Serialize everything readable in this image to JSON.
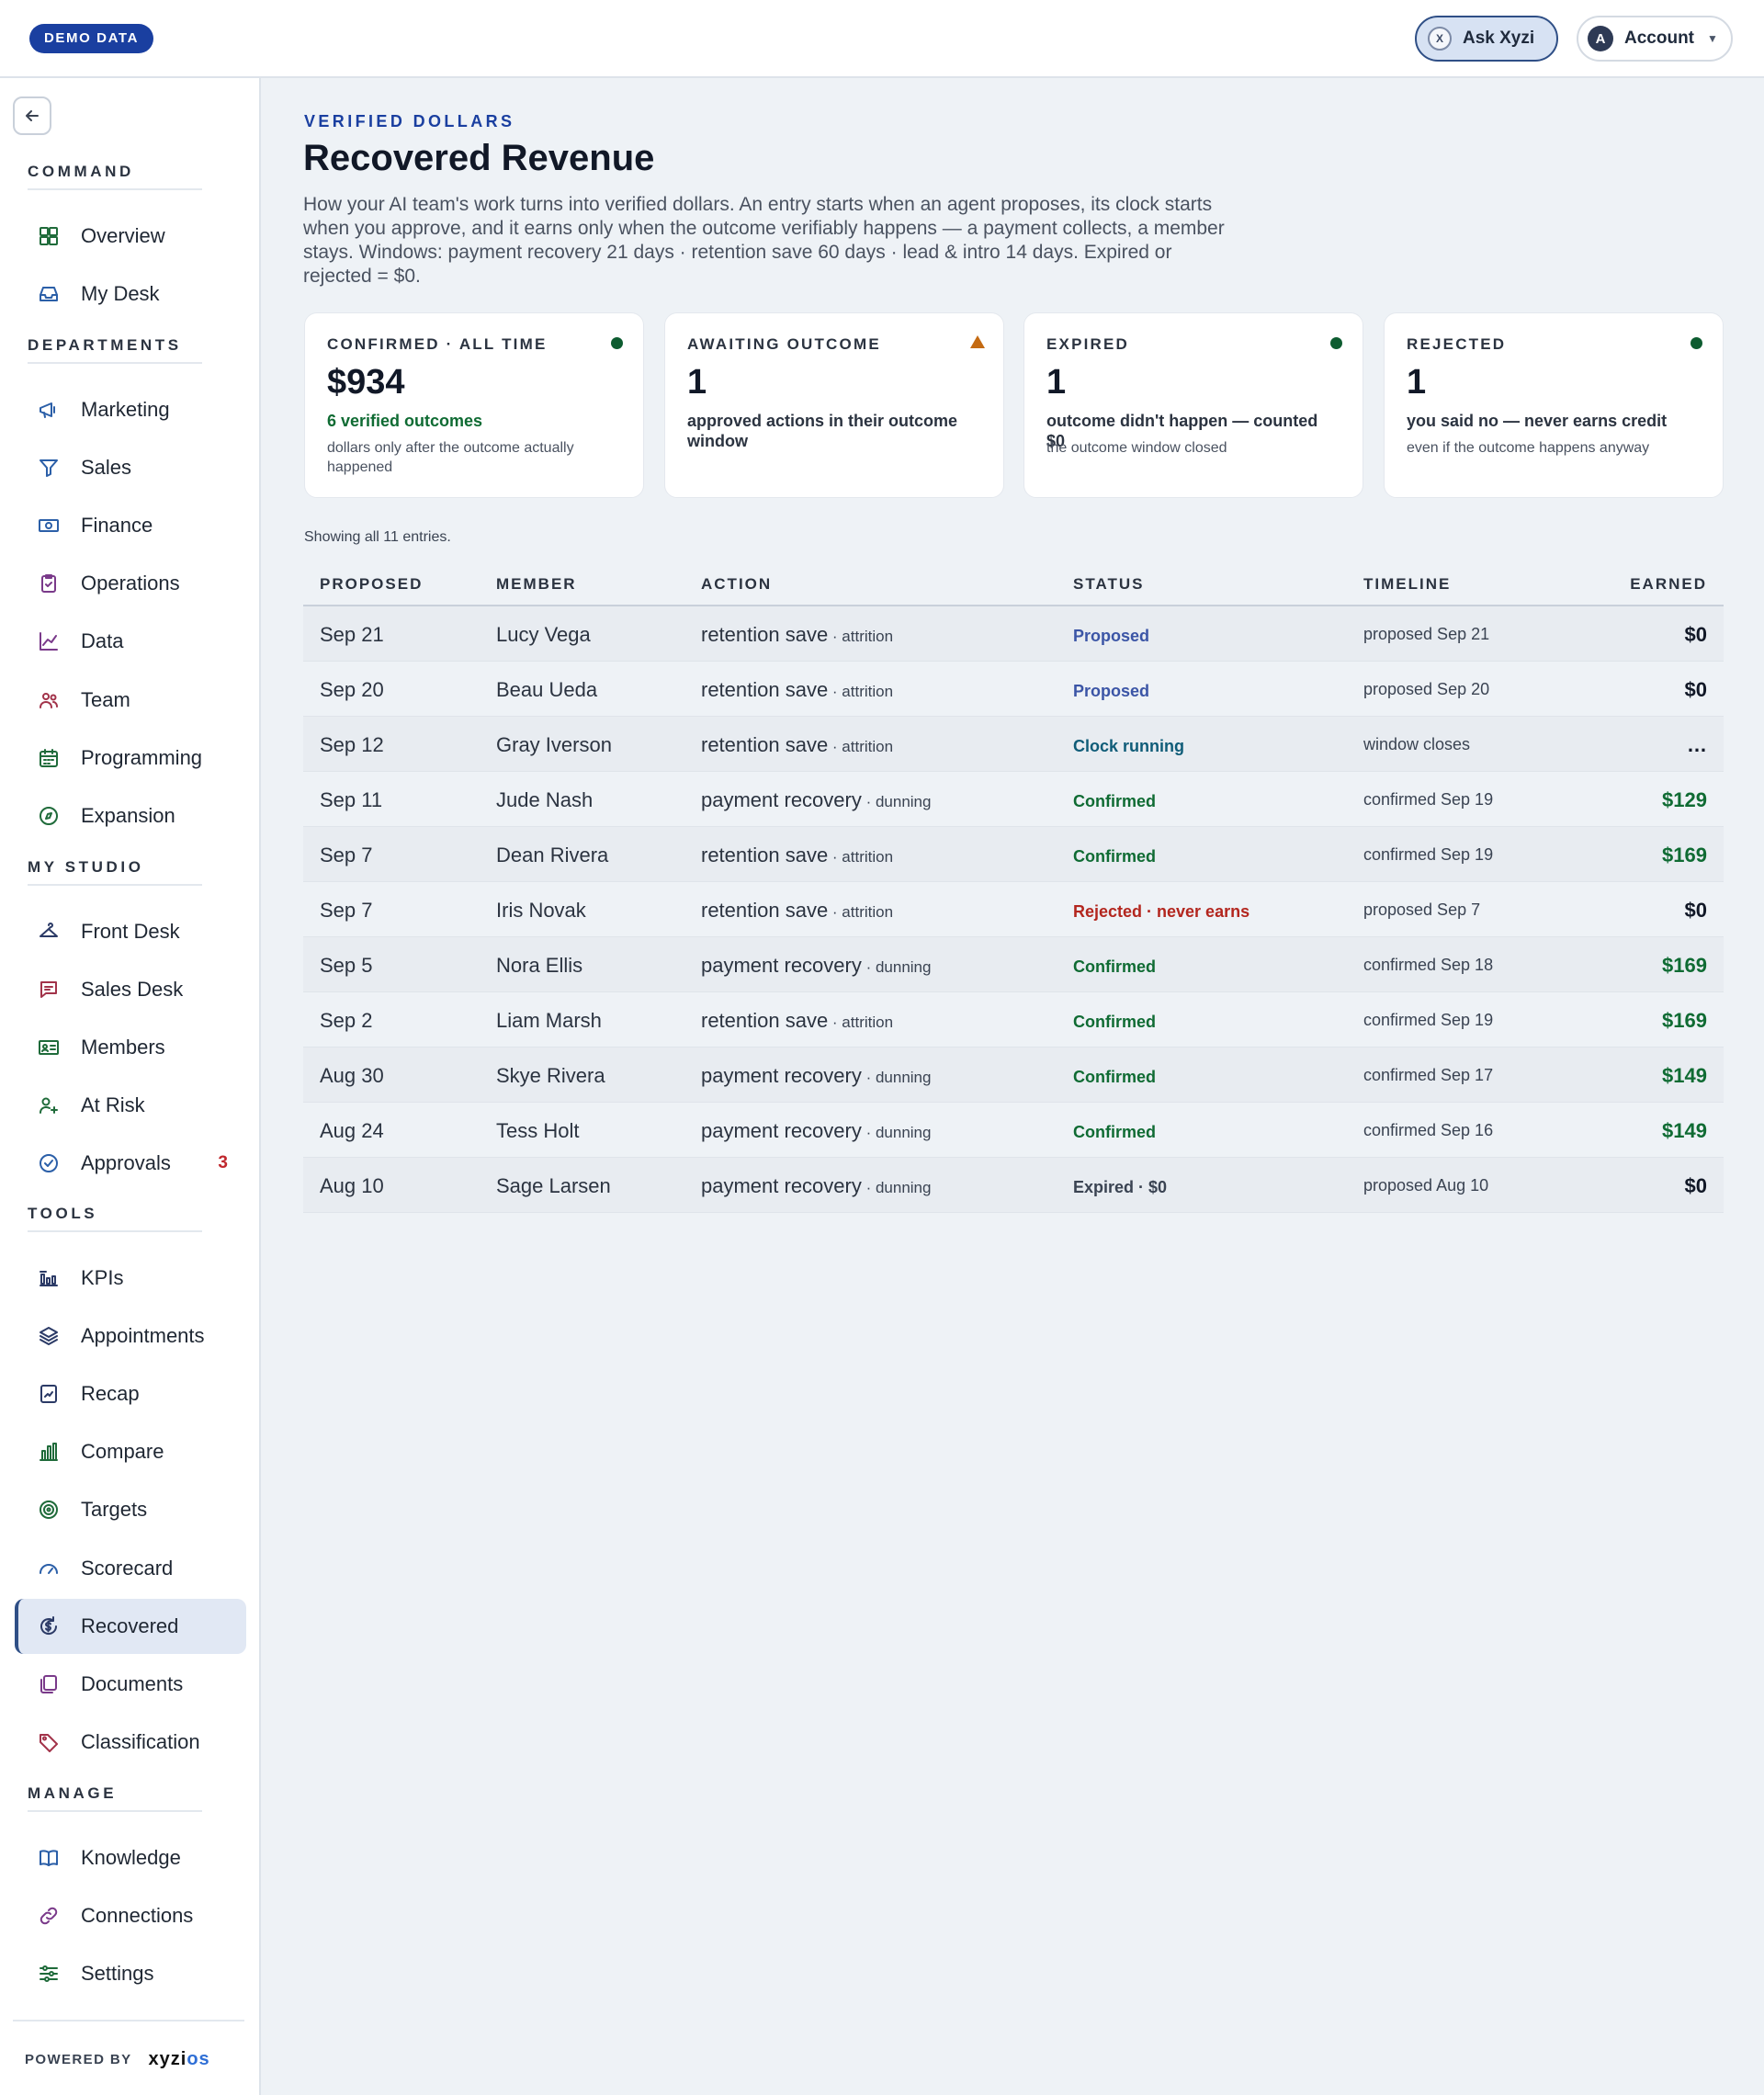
{
  "topbar": {
    "demo_badge": "DEMO DATA",
    "ask_label": "Ask Xyzi",
    "ask_icon_glyph": "X",
    "account_label": "Account",
    "account_avatar": "A",
    "account_caret": "▼"
  },
  "sidebar": {
    "sections": [
      {
        "title": "COMMAND",
        "items": [
          {
            "label": "Overview",
            "icon": "grid-icon",
            "color": "#1f6b3a"
          },
          {
            "label": "My Desk",
            "icon": "inbox-icon",
            "color": "#2b5fa8"
          }
        ]
      },
      {
        "title": "DEPARTMENTS",
        "items": [
          {
            "label": "Marketing",
            "icon": "megaphone-icon",
            "color": "#2b5fa8"
          },
          {
            "label": "Sales",
            "icon": "funnel-icon",
            "color": "#2b5fa8"
          },
          {
            "label": "Finance",
            "icon": "banknote-icon",
            "color": "#2b5fa8"
          },
          {
            "label": "Operations",
            "icon": "clipboard-check-icon",
            "color": "#7a3a8a"
          },
          {
            "label": "Data",
            "icon": "line-chart-icon",
            "color": "#7a3a8a"
          },
          {
            "label": "Team",
            "icon": "users-icon",
            "color": "#a2334a"
          },
          {
            "label": "Programming",
            "icon": "calendar-grid-icon",
            "color": "#1f6b3a"
          },
          {
            "label": "Expansion",
            "icon": "compass-icon",
            "color": "#1f6b3a"
          }
        ]
      },
      {
        "title": "MY STUDIO",
        "items": [
          {
            "label": "Front Desk",
            "icon": "hanger-icon",
            "color": "#2b3a66"
          },
          {
            "label": "Sales Desk",
            "icon": "chat-icon",
            "color": "#a2334a"
          },
          {
            "label": "Members",
            "icon": "id-card-icon",
            "color": "#1f6b3a"
          },
          {
            "label": "At Risk",
            "icon": "user-plus-icon",
            "color": "#1f6b3a"
          },
          {
            "label": "Approvals",
            "icon": "check-circle-icon",
            "color": "#2b5fa8",
            "badge": "3"
          }
        ]
      },
      {
        "title": "TOOLS",
        "items": [
          {
            "label": "KPIs",
            "icon": "bar-columns-icon",
            "color": "#2b3a66"
          },
          {
            "label": "Appointments",
            "icon": "layers-icon",
            "color": "#2b3a66"
          },
          {
            "label": "Recap",
            "icon": "trend-doc-icon",
            "color": "#2b3a66"
          },
          {
            "label": "Compare",
            "icon": "bar-chart-icon",
            "color": "#1f6b3a"
          },
          {
            "label": "Targets",
            "icon": "target-icon",
            "color": "#1f6b3a"
          },
          {
            "label": "Scorecard",
            "icon": "gauge-icon",
            "color": "#2b5fa8"
          },
          {
            "label": "Recovered",
            "icon": "dollar-refresh-icon",
            "color": "#2b3a66",
            "active": true
          },
          {
            "label": "Documents",
            "icon": "documents-icon",
            "color": "#7a3a8a"
          },
          {
            "label": "Classification",
            "icon": "tag-icon",
            "color": "#a2334a"
          }
        ]
      },
      {
        "title": "MANAGE",
        "items": [
          {
            "label": "Knowledge",
            "icon": "book-icon",
            "color": "#2b5fa8"
          },
          {
            "label": "Connections",
            "icon": "link-icon",
            "color": "#7a3a8a"
          },
          {
            "label": "Settings",
            "icon": "sliders-icon",
            "color": "#1f6b3a"
          }
        ]
      }
    ],
    "powered_by": "POWERED BY",
    "brand_main": "xyzi",
    "brand_accent": "os"
  },
  "main": {
    "eyebrow": "VERIFIED DOLLARS",
    "title": "Recovered Revenue",
    "description": "How your AI team's work turns into verified dollars. An entry starts when an agent proposes, its clock starts when you approve, and it earns only when the outcome verifiably happens — a payment collects, a member stays. Windows: payment recovery 21 days · retention save 60 days · lead & intro 14 days. Expired or rejected = $0.",
    "cards": [
      {
        "title": "CONFIRMED · ALL TIME",
        "value": "$934",
        "sub": "6 verified outcomes",
        "note": "dollars only after the outcome actually happened",
        "indicator": "dot",
        "sub_green": true
      },
      {
        "title": "AWAITING OUTCOME",
        "value": "1",
        "sub": "approved actions in their outcome window",
        "note": "",
        "indicator": "triangle"
      },
      {
        "title": "EXPIRED",
        "value": "1",
        "sub": "outcome didn't happen — counted $0",
        "note": "the outcome window closed",
        "indicator": "dot"
      },
      {
        "title": "REJECTED",
        "value": "1",
        "sub": "you said no — never earns credit",
        "note": "even if the outcome happens anyway",
        "indicator": "dot"
      }
    ],
    "showing": "Showing all 11 entries.",
    "table": {
      "headers": {
        "proposed": "PROPOSED",
        "member": "MEMBER",
        "action": "ACTION",
        "status": "STATUS",
        "timeline": "TIMELINE",
        "earned": "EARNED"
      },
      "rows": [
        {
          "proposed": "Sep 21",
          "member": "Lucy Vega",
          "action": "retention save",
          "kind": " · attrition",
          "status": "Proposed",
          "status_color": "#3b55a6",
          "timeline": "proposed Sep 21",
          "earned": "$0",
          "earned_green": false
        },
        {
          "proposed": "Sep 20",
          "member": "Beau Ueda",
          "action": "retention save",
          "kind": " · attrition",
          "status": "Proposed",
          "status_color": "#3b55a6",
          "timeline": "proposed Sep 20",
          "earned": "$0",
          "earned_green": false
        },
        {
          "proposed": "Sep 12",
          "member": "Gray Iverson",
          "action": "retention save",
          "kind": " · attrition",
          "status": "Clock running",
          "status_color": "#0f5c78",
          "timeline": "window closes",
          "earned": "…",
          "earned_green": false
        },
        {
          "proposed": "Sep 11",
          "member": "Jude Nash",
          "action": "payment recovery",
          "kind": " · dunning",
          "status": "Confirmed",
          "status_color": "#0f6b33",
          "timeline": "confirmed Sep 19",
          "earned": "$129",
          "earned_green": true
        },
        {
          "proposed": "Sep 7",
          "member": "Dean Rivera",
          "action": "retention save",
          "kind": " · attrition",
          "status": "Confirmed",
          "status_color": "#0f6b33",
          "timeline": "confirmed Sep 19",
          "earned": "$169",
          "earned_green": true
        },
        {
          "proposed": "Sep 7",
          "member": "Iris Novak",
          "action": "retention save",
          "kind": " · attrition",
          "status": "Rejected · never earns",
          "status_color": "#b3261e",
          "timeline": "proposed Sep 7",
          "earned": "$0",
          "earned_green": false
        },
        {
          "proposed": "Sep 5",
          "member": "Nora Ellis",
          "action": "payment recovery",
          "kind": " · dunning",
          "status": "Confirmed",
          "status_color": "#0f6b33",
          "timeline": "confirmed Sep 18",
          "earned": "$169",
          "earned_green": true
        },
        {
          "proposed": "Sep 2",
          "member": "Liam Marsh",
          "action": "retention save",
          "kind": " · attrition",
          "status": "Confirmed",
          "status_color": "#0f6b33",
          "timeline": "confirmed Sep 19",
          "earned": "$169",
          "earned_green": true
        },
        {
          "proposed": "Aug 30",
          "member": "Skye Rivera",
          "action": "payment recovery",
          "kind": " · dunning",
          "status": "Confirmed",
          "status_color": "#0f6b33",
          "timeline": "confirmed Sep 17",
          "earned": "$149",
          "earned_green": true
        },
        {
          "proposed": "Aug 24",
          "member": "Tess Holt",
          "action": "payment recovery",
          "kind": " · dunning",
          "status": "Confirmed",
          "status_color": "#0f6b33",
          "timeline": "confirmed Sep 16",
          "earned": "$149",
          "earned_green": true
        },
        {
          "proposed": "Aug 10",
          "member": "Sage Larsen",
          "action": "payment recovery",
          "kind": " · dunning",
          "status": "Expired · $0",
          "status_color": "#3a4352",
          "timeline": "proposed Aug 10",
          "earned": "$0",
          "earned_green": false
        }
      ]
    }
  }
}
